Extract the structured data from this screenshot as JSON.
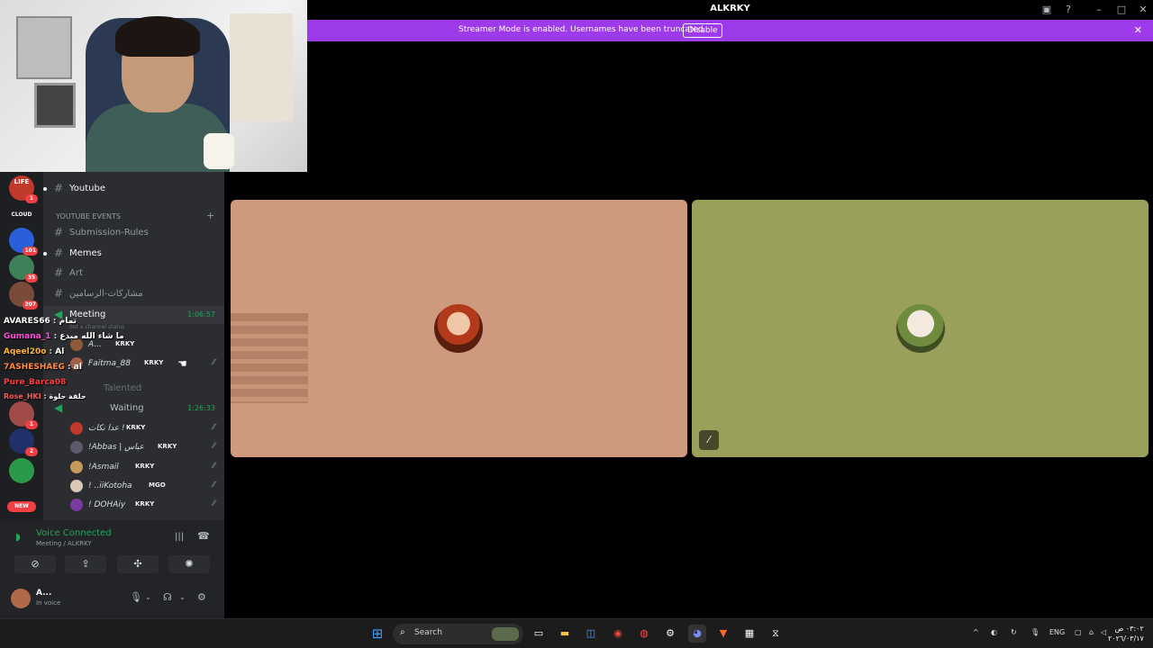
{
  "window": {
    "title": "ALKRKY"
  },
  "banner": {
    "text": "Streamer Mode is enabled. Usernames have been truncated.",
    "button": "Disable"
  },
  "servers": [
    {
      "label": "LIFE",
      "badge": "1"
    },
    {
      "label": "CLOUD",
      "badge": ""
    },
    {
      "label": "",
      "badge": "101"
    },
    {
      "label": "",
      "badge": "35"
    },
    {
      "label": "",
      "badge": "207"
    },
    {
      "label": "",
      "badge": "1"
    },
    {
      "label": "",
      "badge": "2"
    },
    {
      "label": "",
      "badge": ""
    },
    {
      "label": "NEW",
      "badge": ""
    }
  ],
  "channels": {
    "youtube": "Youtube",
    "category": "YOUTUBE EVENTS",
    "submission": "Submission-Rules",
    "memes": "Memes",
    "art": "Art",
    "arabic": "مشاركات-الرسامين",
    "meeting": "Meeting",
    "meeting_time": "1:06:57",
    "meeting_status": "Set a channel status",
    "talented": "Talented",
    "waiting": "Waiting",
    "waiting_time": "1:26:33"
  },
  "meeting_members": [
    {
      "name": "A...",
      "tag": "KRKY"
    },
    {
      "name": "Faitma_88",
      "tag": "KRKY"
    }
  ],
  "waiting_members": [
    {
      "name": "عدا نكات !",
      "tag": "KRKY"
    },
    {
      "name": "!Abbas | عباس",
      "tag": "KRKY"
    },
    {
      "name": "!Asmail",
      "tag": "KRKY"
    },
    {
      "name": "! ..iiKotoha",
      "tag": "MGO"
    },
    {
      "name": "! DOHAiy",
      "tag": "KRKY"
    }
  ],
  "chat": [
    {
      "user": "AVARES66",
      "text": "تمام",
      "color": "#ffffff"
    },
    {
      "user": "Gumana_1",
      "text": "ما شاء الله مبدع",
      "color": "#ff4fd8"
    },
    {
      "user": "Aqeel20o",
      "text": "Al",
      "color": "#ffb43a"
    },
    {
      "user": "7ASHESHAEG",
      "text": "al",
      "color": "#ff8a3a"
    },
    {
      "user": "Pure_Barca08",
      "text": "",
      "color": "#ff3a3a"
    },
    {
      "user": "Rose_HKI",
      "text": "حلقة حلوة",
      "color": "#ff5a5a"
    }
  ],
  "voice": {
    "title": "Voice Connected",
    "subtitle": "Meeting / ALKRKY"
  },
  "user": {
    "name": "A...",
    "status": "In voice"
  },
  "taskbar": {
    "search": "Search",
    "lang": "ENG",
    "time": "٠٣:٠٢ ص",
    "date": "٢٠٢٦/٠٣/١٧"
  },
  "colors": {
    "banner": "#9d3aea",
    "tile1": "#cd9a7d",
    "tile2": "#9b9f5c",
    "voice_green": "#23a559"
  }
}
